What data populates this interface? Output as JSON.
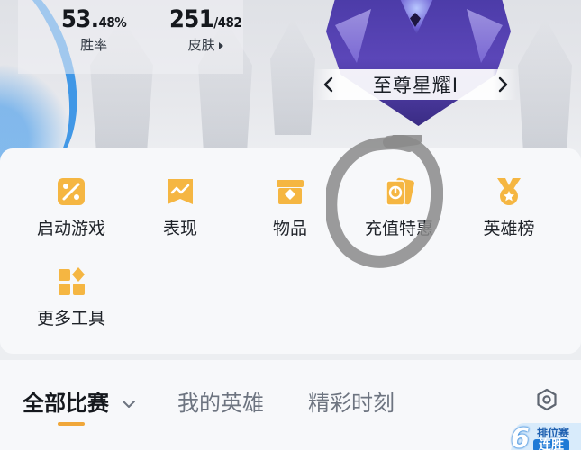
{
  "stats": {
    "winrate": {
      "value_main": "53.",
      "value_small": "48%",
      "label": "胜率"
    },
    "skins": {
      "value_main": "251",
      "value_small": "/482",
      "label": "皮肤"
    }
  },
  "rank": {
    "name": "至尊星耀Ⅰ",
    "prev_icon": "chevron-left-icon",
    "next_icon": "chevron-right-icon"
  },
  "tools": [
    {
      "label": "启动游戏",
      "icon": "launch-game-icon"
    },
    {
      "label": "表现",
      "icon": "performance-icon"
    },
    {
      "label": "物品",
      "icon": "items-icon"
    },
    {
      "label": "充值特惠",
      "icon": "recharge-offer-icon"
    },
    {
      "label": "英雄榜",
      "icon": "hero-ranking-icon"
    },
    {
      "label": "更多工具",
      "icon": "more-tools-icon"
    }
  ],
  "tabs": [
    {
      "label": "全部比赛",
      "active": true
    },
    {
      "label": "我的英雄",
      "active": false
    },
    {
      "label": "精彩时刻",
      "active": false
    }
  ],
  "badge": {
    "number": "6",
    "top": "排位赛",
    "bottom": "连胜"
  },
  "colors": {
    "accent": "#f0a73a",
    "icon_fill": "#f5b642",
    "rank_purple": "#4a3aa6",
    "blue": "#2f8fe6"
  }
}
